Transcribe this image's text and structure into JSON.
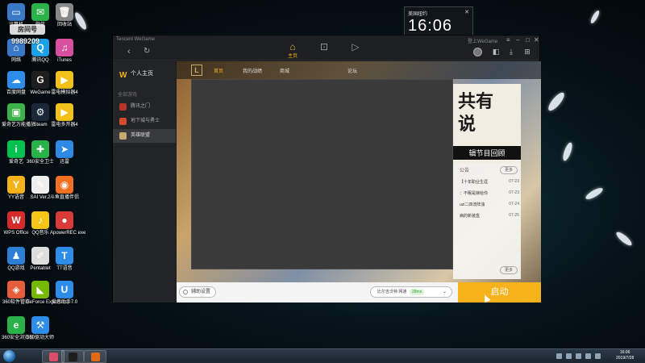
{
  "desktop": {
    "room_badge": "房间号",
    "room_number": "9989209",
    "icons": [
      {
        "label": "计算机",
        "color": "#3a78c8",
        "glyph": "▭"
      },
      {
        "label": "微信",
        "color": "#2bb34a",
        "glyph": "✉"
      },
      {
        "label": "回收站",
        "color": "#888888",
        "glyph": "🗑"
      },
      {
        "label": "网络",
        "color": "#3a78c8",
        "glyph": "⌂"
      },
      {
        "label": "腾讯QQ",
        "color": "#1aa1e6",
        "glyph": "Q"
      },
      {
        "label": "iTunes",
        "color": "#d94fa0",
        "glyph": "♫"
      },
      {
        "label": "百度网盘",
        "color": "#2d8de8",
        "glyph": "☁"
      },
      {
        "label": "WeGame",
        "color": "#1e1e1e",
        "glyph": "G"
      },
      {
        "label": "雷电模拟器4",
        "color": "#f2c21b",
        "glyph": "▶"
      },
      {
        "label": "爱奇艺万能播放",
        "color": "#3cb34a",
        "glyph": "▣"
      },
      {
        "label": "Steam",
        "color": "#1b2838",
        "glyph": "⚙"
      },
      {
        "label": "雷电多开器4",
        "color": "#f2c21b",
        "glyph": "▶"
      },
      {
        "label": "爱奇艺",
        "color": "#00c250",
        "glyph": "i"
      },
      {
        "label": "360安全卫士",
        "color": "#2ab24a",
        "glyph": "✚"
      },
      {
        "label": "迅雷",
        "color": "#2f8ae5",
        "glyph": "➤"
      },
      {
        "label": "YY语音",
        "color": "#f6b21b",
        "glyph": "Y"
      },
      {
        "label": "SAI Ver.2",
        "color": "#eeeeee",
        "glyph": "✎"
      },
      {
        "label": "斗鱼直播伴侣",
        "color": "#f27024",
        "glyph": "◉"
      },
      {
        "label": "WPS Office",
        "color": "#d52b2b",
        "glyph": "W"
      },
      {
        "label": "QQ音乐",
        "color": "#f5c518",
        "glyph": "♪"
      },
      {
        "label": "ApowerREC exe",
        "color": "#d83a3a",
        "glyph": "●"
      },
      {
        "label": "QQ游戏",
        "color": "#2d7fd6",
        "glyph": "♟"
      },
      {
        "label": "Pentablet",
        "color": "#dddddd",
        "glyph": "✐"
      },
      {
        "label": "TT语音",
        "color": "#2d8de8",
        "glyph": "T"
      },
      {
        "label": "360软件管家",
        "color": "#e65d3c",
        "glyph": "◈"
      },
      {
        "label": "GeForce Experience",
        "color": "#76b900",
        "glyph": "◣"
      },
      {
        "label": "爱思助手7.0",
        "color": "#2d8de8",
        "glyph": "U"
      },
      {
        "label": "360安全浏览器",
        "color": "#2ab24a",
        "glyph": "e"
      },
      {
        "label": "360驱动大师",
        "color": "#2d8de8",
        "glyph": "⚒"
      }
    ]
  },
  "clock": {
    "city": "美国纽约",
    "time": "16:06"
  },
  "wegame": {
    "brand": "Tencent WeGame",
    "window_title": "登上WeGame",
    "top_tabs": [
      {
        "label": "主页",
        "glyph": "⌂",
        "active": true
      },
      {
        "label": "",
        "glyph": "▾",
        "active": false
      },
      {
        "label": "",
        "glyph": "▷",
        "active": false
      }
    ],
    "profile": {
      "logo": "W",
      "label": "个人主页"
    },
    "side_header": "全部游戏",
    "side_items": [
      {
        "label": "腾讯之门",
        "color": "#b8342a",
        "active": false
      },
      {
        "label": "地下城与勇士",
        "color": "#d44a2a",
        "active": false
      },
      {
        "label": "英雄联盟",
        "color": "#c8aa6e",
        "active": true
      }
    ],
    "lol": {
      "logo": "L",
      "tabs": [
        {
          "label": "首页",
          "active": true
        },
        {
          "label": "我的战绩",
          "active": false
        },
        {
          "label": "商城",
          "active": false
        },
        {
          "label": "",
          "active": false
        },
        {
          "label": "论坛",
          "active": false
        },
        {
          "label": "",
          "active": false
        }
      ],
      "banner_text": "共有\n说",
      "banner_sub": "辑节目回顾",
      "news_label": "公告",
      "more_top": "更多",
      "more_bottom": "更多",
      "news": [
        {
          "title": "【十年职业生涯",
          "date": "07-23"
        },
        {
          "title": "：不眠是嫁给你",
          "date": "07-23"
        },
        {
          "title": "uzi二四流阵浊",
          "date": "07-24"
        },
        {
          "title": "病的新装盒",
          "date": "07-25"
        }
      ]
    },
    "bottom": {
      "assist": "辅助设置",
      "server": "比尔吉沃特 网通",
      "ping": "28ms",
      "launch": "启动"
    }
  },
  "taskbar": {
    "tray_time": "16:06",
    "tray_date": "2019/7/28",
    "items": [
      {
        "color": "#d94f6a"
      },
      {
        "color": "#1e1e1e"
      },
      {
        "color": "#e06a1a"
      }
    ]
  }
}
